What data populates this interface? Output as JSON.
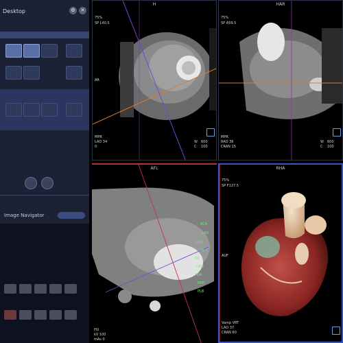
{
  "left_panel": {
    "title": "Desktop",
    "tool_icons": [
      "gear-icon",
      "close-icon"
    ],
    "section_label": "Image Navigator"
  },
  "viewports": {
    "h": {
      "label": "H",
      "zoom": "75%",
      "slab": "SP L40.5",
      "orientation_left": "AR",
      "bottom_left": [
        "MPR",
        "LAO 34",
        "0"
      ],
      "bottom_right_keys": [
        "W",
        "C"
      ],
      "bottom_right_vals": [
        "600",
        "100"
      ]
    },
    "har": {
      "label": "HAR",
      "zoom": "75%",
      "slab": "SP A59.5",
      "bottom_left": [
        "MPR",
        "RAO 36",
        "CRAN 15"
      ],
      "bottom_right_keys": [
        "W",
        "C"
      ],
      "bottom_right_vals": [
        "600",
        "100"
      ]
    },
    "afl": {
      "label": "AFL",
      "bottom_left": [
        "HU",
        "kV 100",
        "mAs 0"
      ],
      "annotations": [
        "RCA",
        "LAD",
        "LCX",
        "LM",
        "D1",
        "OM1",
        "PDA",
        "RPD",
        "PLB"
      ]
    },
    "rha": {
      "label": "RHA",
      "zoom": "75%",
      "slab": "SP F127.5",
      "orientation_left": "AUF",
      "bottom_left": [
        "Vamp VRT",
        "LAO 37",
        "CRAN 60"
      ]
    }
  },
  "colors": {
    "panel_bg": "#1b2236",
    "selection": "#3f4a78",
    "annotation_green": "#6ff06f",
    "crosshair_orange": "#e07a2a",
    "crosshair_purple": "#6a4ad8",
    "active_border_red": "#b0343a",
    "active_border_blue": "#3a56c4"
  }
}
